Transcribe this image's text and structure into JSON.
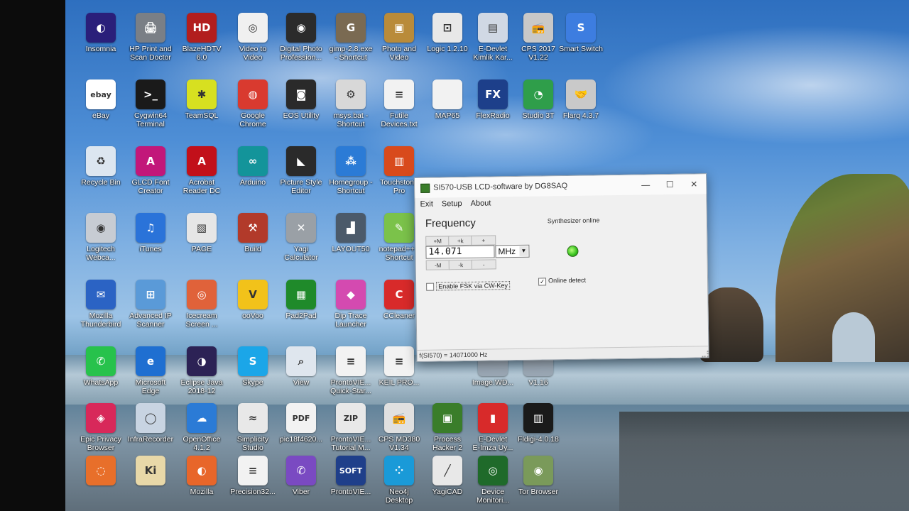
{
  "desktop": {
    "icons": [
      {
        "label": "Insomnia",
        "icon": "insomnia-icon",
        "glyph": "◐",
        "color": "#2a1f7a"
      },
      {
        "label": "HP Print and\nScan Doctor",
        "icon": "printer-icon",
        "glyph": "🖨",
        "color": "#7a7f86"
      },
      {
        "label": "BlazeHDTV\n6.0",
        "icon": "tv-icon",
        "glyph": "HD",
        "color": "#b21e1e"
      },
      {
        "label": "Video to\nVideo",
        "icon": "film-reel-icon",
        "glyph": "◎",
        "color": "#f0f0f0"
      },
      {
        "label": "Digital Photo\nProfession...",
        "icon": "camera-icon",
        "glyph": "◉",
        "color": "#2b2b2b"
      },
      {
        "label": "gimp-2.8.exe\n- Shortcut",
        "icon": "gimp-icon",
        "glyph": "G",
        "color": "#7a6a52"
      },
      {
        "label": "Photo and\nVideo",
        "icon": "photo-icon",
        "glyph": "▣",
        "color": "#b98b3a"
      },
      {
        "label": "Logic 1.2.10",
        "icon": "logic-analyzer-icon",
        "glyph": "⊡",
        "color": "#e8e8e8"
      },
      {
        "label": "E-Devlet\nKimlik Kar...",
        "icon": "id-card-icon",
        "glyph": "▤",
        "color": "#d0d8e4"
      },
      {
        "label": "CPS 2017\nV1.22",
        "icon": "radio-icon",
        "glyph": "📻",
        "color": "#c8c8c8"
      },
      {
        "label": "Smart Switch",
        "icon": "smart-switch-icon",
        "glyph": "S",
        "color": "#3d7de0"
      },
      {
        "label": "eBay",
        "icon": "ebay-icon",
        "glyph": "ebay",
        "color": "#ffffff"
      },
      {
        "label": "Cygwin64\nTerminal",
        "icon": "terminal-icon",
        "glyph": ">_",
        "color": "#1a1a1a"
      },
      {
        "label": "TeamSQL",
        "icon": "teamsql-icon",
        "glyph": "✱",
        "color": "#d7e020"
      },
      {
        "label": "Google\nChrome",
        "icon": "chrome-icon",
        "glyph": "◍",
        "color": "#d93a2f"
      },
      {
        "label": "EOS Utility",
        "icon": "eos-camera-icon",
        "glyph": "◙",
        "color": "#2a2a2a"
      },
      {
        "label": "msys.bat -\nShortcut",
        "icon": "gear-file-icon",
        "glyph": "⚙",
        "color": "#d8d8d8"
      },
      {
        "label": "Futile\nDevices.txt",
        "icon": "text-file-icon",
        "glyph": "≡",
        "color": "#f2f2f2"
      },
      {
        "label": "MAP65",
        "icon": "file-icon",
        "glyph": "",
        "color": "#f2f2f2"
      },
      {
        "label": "FlexRadio",
        "icon": "flexradio-icon",
        "glyph": "FX",
        "color": "#1d3f8a"
      },
      {
        "label": "Studio 3T",
        "icon": "studio3t-icon",
        "glyph": "◔",
        "color": "#2f9e4a"
      },
      {
        "label": "Flarq 4.3.7",
        "icon": "handshake-icon",
        "glyph": "🤝",
        "color": "#c9c9c9"
      },
      {
        "label": "Recycle Bin",
        "icon": "recycle-bin-icon",
        "glyph": "♻",
        "color": "#dce6f0"
      },
      {
        "label": "GLCD Font\nCreator",
        "icon": "glcd-font-icon",
        "glyph": "A",
        "color": "#c2177a"
      },
      {
        "label": "Acrobat\nReader DC",
        "icon": "acrobat-icon",
        "glyph": "A",
        "color": "#c2101a"
      },
      {
        "label": "Arduino",
        "icon": "arduino-icon",
        "glyph": "∞",
        "color": "#13949a"
      },
      {
        "label": "Picture Style\nEditor",
        "icon": "picture-style-icon",
        "glyph": "◣",
        "color": "#2a2a2a"
      },
      {
        "label": "Homegroup -\nShortcut",
        "icon": "homegroup-icon",
        "glyph": "⁂",
        "color": "#2b7bd6"
      },
      {
        "label": "Touchstone\nPro",
        "icon": "touchstone-icon",
        "glyph": "▥",
        "color": "#d84a1c"
      },
      {
        "label": "Logitech\nWebca...",
        "icon": "webcam-icon",
        "glyph": "◉",
        "color": "#c7ccd3"
      },
      {
        "label": "iTunes",
        "icon": "itunes-icon",
        "glyph": "♫",
        "color": "#2a73d9"
      },
      {
        "label": "PAGE",
        "icon": "page-icon",
        "glyph": "▧",
        "color": "#e6e6e6"
      },
      {
        "label": "Build",
        "icon": "tools-icon",
        "glyph": "⚒",
        "color": "#b23a2a"
      },
      {
        "label": "Yagi\nCalculator",
        "icon": "antenna-icon",
        "glyph": "✕",
        "color": "#9aa0a6"
      },
      {
        "label": "LAYOUT50",
        "icon": "layout-icon",
        "glyph": "▟",
        "color": "#4b5a6a"
      },
      {
        "label": "notepad++ -\nShortcut",
        "icon": "notepad-icon",
        "glyph": "✎",
        "color": "#7bc24a"
      },
      {
        "label": "Mozilla\nThunderbird",
        "icon": "thunderbird-icon",
        "glyph": "✉",
        "color": "#2b63c4"
      },
      {
        "label": "Advanced IP\nScanner",
        "icon": "network-icon",
        "glyph": "⊞",
        "color": "#5a9ad8"
      },
      {
        "label": "Icecream\nScreen ...",
        "icon": "screen-recorder-icon",
        "glyph": "◎",
        "color": "#e0623a"
      },
      {
        "label": "ooVoo",
        "icon": "oovoo-icon",
        "glyph": "V",
        "color": "#f2c21a"
      },
      {
        "label": "Pad2Pad",
        "icon": "pcb-icon",
        "glyph": "▦",
        "color": "#1f8a2a"
      },
      {
        "label": "Dip Trace\nLauncher",
        "icon": "diptrace-icon",
        "glyph": "◆",
        "color": "#d44ab0"
      },
      {
        "label": "CCleaner",
        "icon": "ccleaner-icon",
        "glyph": "C",
        "color": "#d82a2a"
      },
      {
        "label": "WhatsApp",
        "icon": "whatsapp-icon",
        "glyph": "✆",
        "color": "#27c24c"
      },
      {
        "label": "Microsoft\nEdge",
        "icon": "edge-icon",
        "glyph": "e",
        "color": "#1f6fd1"
      },
      {
        "label": "Eclipse Java\n2018-12",
        "icon": "eclipse-icon",
        "glyph": "◑",
        "color": "#2c2255"
      },
      {
        "label": "Skype",
        "icon": "skype-icon",
        "glyph": "S",
        "color": "#1ba6e8"
      },
      {
        "label": "View",
        "icon": "view-icon",
        "glyph": "⌕",
        "color": "#dfe6ee"
      },
      {
        "label": "ProntoVIE...\nQuick-Star...",
        "icon": "document-icon",
        "glyph": "≡",
        "color": "#f2f2f2"
      },
      {
        "label": "KEIL PRO...",
        "icon": "document-icon",
        "glyph": "≡",
        "color": "#f2f2f2"
      },
      {
        "label": "Epic Privacy\nBrowser",
        "icon": "epic-browser-icon",
        "glyph": "◈",
        "color": "#d8285a"
      },
      {
        "label": "InfraRecorder",
        "icon": "infrarecorder-icon",
        "glyph": "◯",
        "color": "#c8d4e2"
      },
      {
        "label": "OpenOffice\n4.1.2",
        "icon": "openoffice-icon",
        "glyph": "☁",
        "color": "#2b7bd6"
      },
      {
        "label": "Simplicity\nStudio",
        "icon": "simplicity-icon",
        "glyph": "≈",
        "color": "#e8e8e8"
      },
      {
        "label": "pic18f4620...",
        "icon": "pdf-icon",
        "glyph": "PDF",
        "color": "#f2f2f2"
      },
      {
        "label": "ProntoVIE...\nTutorial M...",
        "icon": "zip-icon",
        "glyph": "ZIP",
        "color": "#e8e8e8"
      },
      {
        "label": "CPS MD380\nV1.34",
        "icon": "radio-icon",
        "glyph": "📻",
        "color": "#e0e0e0"
      },
      {
        "label": "Process\nHacker 2",
        "icon": "process-hacker-icon",
        "glyph": "▣",
        "color": "#3a7d2a"
      },
      {
        "label": "E-Devlet\nE-İmza Uy...",
        "icon": "e-imza-icon",
        "glyph": "▮",
        "color": "#d82a2a"
      },
      {
        "label": "Fldigi-4.0.18",
        "icon": "fldigi-icon",
        "glyph": "▥",
        "color": "#1a1a1a"
      },
      {
        "label": "",
        "icon": "app-icon",
        "glyph": "◌",
        "color": "#e86f2a"
      },
      {
        "label": "",
        "icon": "ki-icon",
        "glyph": "Ki",
        "color": "#e8d8a8"
      },
      {
        "label": "Mozilla",
        "icon": "firefox-icon",
        "glyph": "◐",
        "color": "#e8662a"
      },
      {
        "label": "Precision32...",
        "icon": "document-icon",
        "glyph": "≡",
        "color": "#f2f2f2"
      },
      {
        "label": "Viber",
        "icon": "viber-icon",
        "glyph": "✆",
        "color": "#7a4ac2"
      },
      {
        "label": "ProntoVIE...",
        "icon": "soft-icon",
        "glyph": "SOFT",
        "color": "#1f3f8a"
      },
      {
        "label": "Neo4j\nDesktop",
        "icon": "neo4j-icon",
        "glyph": "⁘",
        "color": "#1a9ad8"
      },
      {
        "label": "YagiCAD",
        "icon": "yagicad-icon",
        "glyph": "╱",
        "color": "#e8e8e8"
      },
      {
        "label": "Device\nMonitori...",
        "icon": "radar-icon",
        "glyph": "◎",
        "color": "#1f6a2a"
      },
      {
        "label": "Tor Browser",
        "icon": "tor-icon",
        "glyph": "◉",
        "color": "#7a9a5a"
      },
      {
        "label": "Image.WD...",
        "icon": "image-file-icon",
        "glyph": "",
        "color": "#9aa7b4"
      },
      {
        "label": "V1.16",
        "icon": "file-icon",
        "glyph": "",
        "color": "#9aa7b4"
      }
    ]
  },
  "window": {
    "title": "SI570-USB LCD-software by DG8SAQ",
    "menu": [
      "Exit",
      "Setup",
      "About"
    ],
    "frequency_heading": "Frequency",
    "synth_status": "Synthesizer online",
    "step_up": [
      "+M",
      "+k",
      "+"
    ],
    "step_down": [
      "-M",
      "-k",
      "-"
    ],
    "frequency_value": "14.071",
    "unit": "MHz",
    "fsk_label": "Enable FSK via CW-Key",
    "fsk_checked": false,
    "online_detect_label": "Online detect",
    "online_detect_checked": true,
    "status_text": "f(SI570) = 14071000 Hz",
    "led_color": "#35c11d"
  }
}
